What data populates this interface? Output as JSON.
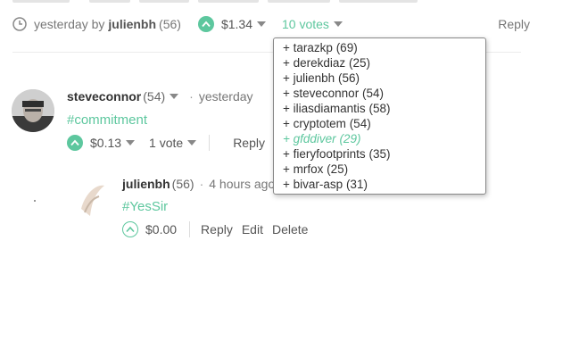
{
  "post_meta": {
    "time_prefix": "yesterday by",
    "author": "julienbh",
    "author_rep": "(56)",
    "payout": "$1.34",
    "votes_label": "10 votes",
    "reply_label": "Reply"
  },
  "votes_dropdown": {
    "items": [
      {
        "prefix": "+ ",
        "name": "tarazkp",
        "rep": "(69)",
        "color": "#333333"
      },
      {
        "prefix": "+ ",
        "name": "derekdiaz",
        "rep": "(25)",
        "color": "#333333"
      },
      {
        "prefix": "+ ",
        "name": "julienbh",
        "rep": "(56)",
        "color": "#333333"
      },
      {
        "prefix": "+ ",
        "name": "steveconnor",
        "rep": "(54)",
        "color": "#333333"
      },
      {
        "prefix": "+ ",
        "name": "iliasdiamantis",
        "rep": "(58)",
        "color": "#333333"
      },
      {
        "prefix": "+ ",
        "name": "cryptotem",
        "rep": "(54)",
        "color": "#333333"
      },
      {
        "prefix": "+ ",
        "name": "gfddiver",
        "rep": "(29)",
        "color": "#5dc79e"
      },
      {
        "prefix": "+ ",
        "name": "fieryfootprints",
        "rep": "(35)",
        "color": "#333333"
      },
      {
        "prefix": "+ ",
        "name": "mrfox",
        "rep": "(25)",
        "color": "#333333"
      },
      {
        "prefix": "+ ",
        "name": "bivar-asp",
        "rep": "(31)",
        "color": "#333333"
      }
    ]
  },
  "comment1": {
    "author": "steveconnor",
    "rep": "(54)",
    "separator": "·",
    "time": "yesterday",
    "tag": "#commitment",
    "payout": "$0.13",
    "votes_label": "1 vote",
    "reply_label": "Reply"
  },
  "comment2": {
    "author": "julienbh",
    "rep": "(56)",
    "separator": "·",
    "time": "4 hours ago",
    "tag": "#YesSir",
    "payout": "$0.00",
    "reply_label": "Reply",
    "edit_label": "Edit",
    "delete_label": "Delete"
  },
  "colors": {
    "accent": "#5dc79e",
    "text": "#333333",
    "muted": "#777777"
  }
}
